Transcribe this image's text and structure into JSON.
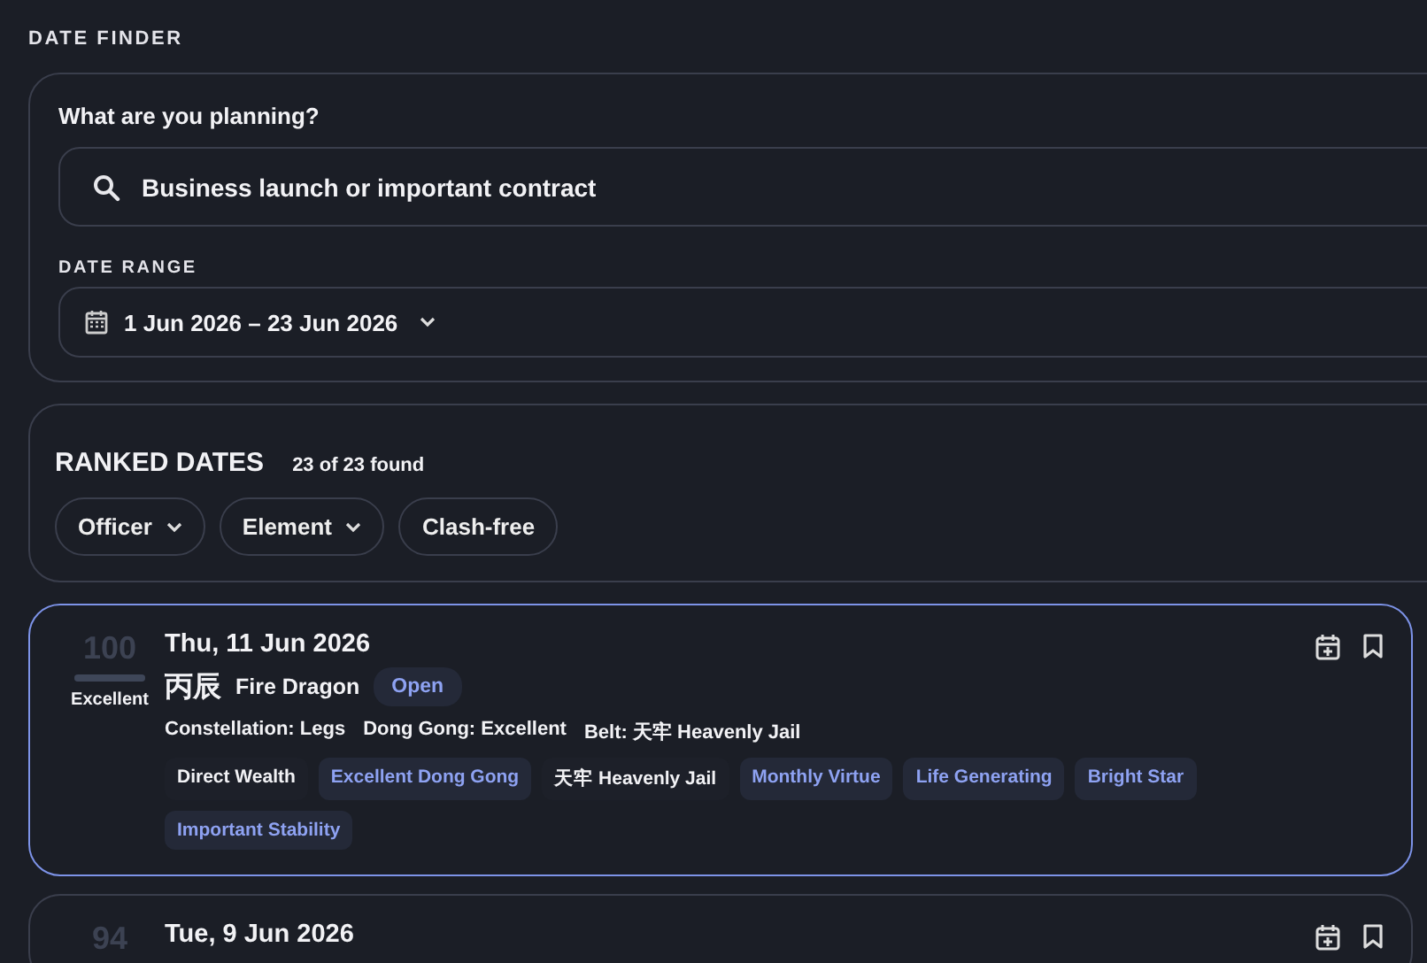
{
  "page_title": "DATE FINDER",
  "planner": {
    "question": "What are you planning?",
    "search": {
      "value": "Business launch or important contract"
    },
    "range_label": "DATE RANGE",
    "range": {
      "value": "1 Jun 2026 – 23 Jun 2026"
    }
  },
  "results": {
    "title": "RANKED DATES",
    "count": "23 of 23 found",
    "filters": [
      {
        "label": "Officer",
        "dropdown": true
      },
      {
        "label": "Element",
        "dropdown": true
      },
      {
        "label": "Clash-free",
        "dropdown": false
      }
    ]
  },
  "dates": [
    {
      "score": "100",
      "level": 1,
      "rating": "Excellent",
      "date": "Thu, 11 Jun 2026",
      "pillar": "丙辰",
      "pillar_name": "Fire Dragon",
      "officer": "Open",
      "selected": true,
      "details": [
        "Constellation: Legs",
        "Dong Gong: Excellent",
        "Belt: 天牢 Heavenly Jail"
      ],
      "tags": [
        {
          "label": "Direct Wealth",
          "highlighted": false
        },
        {
          "label": "Excellent Dong Gong",
          "highlighted": true
        },
        {
          "label": "天牢 Heavenly Jail",
          "highlighted": false
        },
        {
          "label": "Monthly Virtue",
          "highlighted": true
        },
        {
          "label": "Life Generating",
          "highlighted": true
        },
        {
          "label": "Bright Star",
          "highlighted": true
        },
        {
          "label": "Important Stability",
          "highlighted": true
        }
      ]
    },
    {
      "score": "94",
      "date": "Tue, 9 Jun 2026",
      "selected": false
    }
  ]
}
